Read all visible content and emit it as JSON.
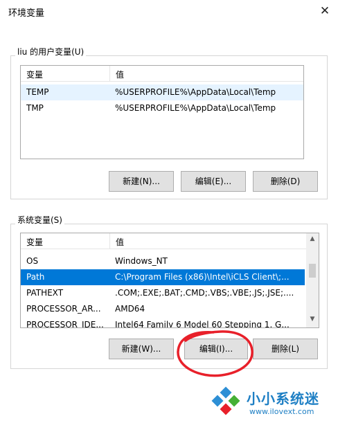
{
  "window": {
    "title": "环境变量",
    "close_glyph": "✕"
  },
  "user_vars": {
    "group_label": "liu 的用户变量(U)",
    "headers": [
      "变量",
      "值"
    ],
    "rows": [
      {
        "name": "TEMP",
        "value": "%USERPROFILE%\\AppData\\Local\\Temp"
      },
      {
        "name": "TMP",
        "value": "%USERPROFILE%\\AppData\\Local\\Temp"
      }
    ],
    "buttons": {
      "new": "新建(N)...",
      "edit": "编辑(E)...",
      "delete": "删除(D)"
    }
  },
  "system_vars": {
    "group_label": "系统变量(S)",
    "headers": [
      "变量",
      "值"
    ],
    "rows": [
      {
        "name": "OS",
        "value": "Windows_NT"
      },
      {
        "name": "Path",
        "value": "C:\\Program Files (x86)\\Intel\\iCLS Client\\;..."
      },
      {
        "name": "PATHEXT",
        "value": ".COM;.EXE;.BAT;.CMD;.VBS;.VBE;.JS;.JSE;...."
      },
      {
        "name": "PROCESSOR_AR...",
        "value": "AMD64"
      },
      {
        "name": "PROCESSOR_IDE...",
        "value": "Intel64 Family 6 Model 60 Stepping 1, G..."
      }
    ],
    "selected_index": 1,
    "buttons": {
      "new": "新建(W)...",
      "edit": "编辑(I)...",
      "delete": "删除(L)"
    }
  },
  "annotation": {
    "color": "#e8202a"
  },
  "watermark": {
    "title": "小小系统迷",
    "url": "www.iIovext.com"
  },
  "colors": {
    "selection": "#0078d7",
    "row_hover": "#e5f3ff",
    "logo_blue": "#1e7fc4"
  }
}
